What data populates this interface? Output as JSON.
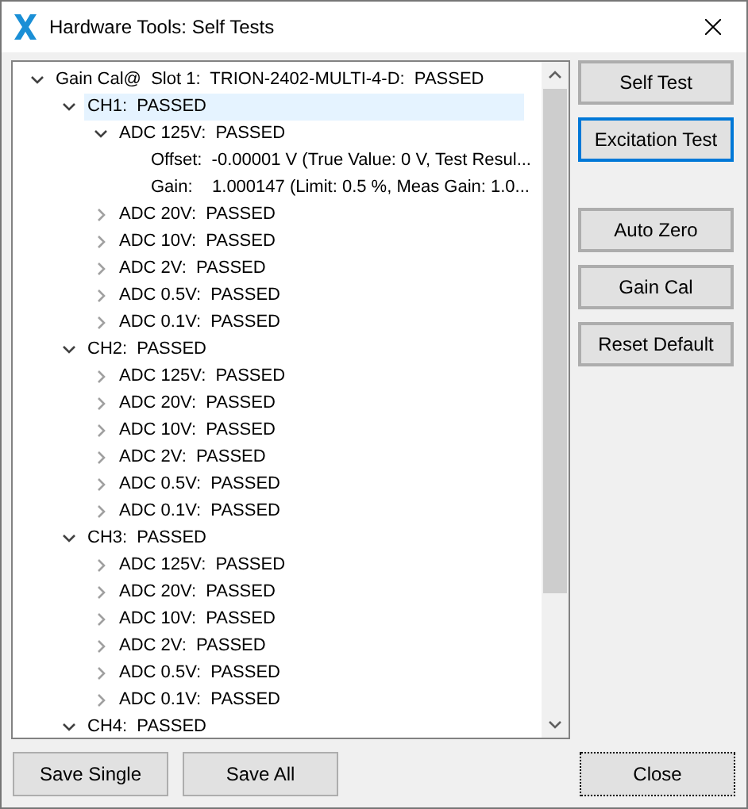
{
  "window": {
    "title": "Hardware Tools: Self Tests"
  },
  "tree": [
    {
      "label": "Gain Cal@  Slot 1:  TRION-2402-MULTI-4-D:  PASSED",
      "expanded": true,
      "selected": false,
      "children": [
        {
          "label": "CH1:  PASSED",
          "expanded": true,
          "selected": true,
          "children": [
            {
              "label": "ADC 125V:  PASSED",
              "expanded": true,
              "selected": false,
              "children": [
                {
                  "label": "Offset:  -0.00001 V (True Value: 0 V, Test Resul...",
                  "selected": false
                },
                {
                  "label": "Gain:    1.000147 (Limit: 0.5 %, Meas Gain: 1.0...",
                  "selected": false
                }
              ]
            },
            {
              "label": "ADC 20V:  PASSED",
              "expanded": false,
              "selected": false
            },
            {
              "label": "ADC 10V:  PASSED",
              "expanded": false,
              "selected": false
            },
            {
              "label": "ADC 2V:  PASSED",
              "expanded": false,
              "selected": false
            },
            {
              "label": "ADC 0.5V:  PASSED",
              "expanded": false,
              "selected": false
            },
            {
              "label": "ADC 0.1V:  PASSED",
              "expanded": false,
              "selected": false
            }
          ]
        },
        {
          "label": "CH2:  PASSED",
          "expanded": true,
          "selected": false,
          "children": [
            {
              "label": "ADC 125V:  PASSED",
              "expanded": false,
              "selected": false
            },
            {
              "label": "ADC 20V:  PASSED",
              "expanded": false,
              "selected": false
            },
            {
              "label": "ADC 10V:  PASSED",
              "expanded": false,
              "selected": false
            },
            {
              "label": "ADC 2V:  PASSED",
              "expanded": false,
              "selected": false
            },
            {
              "label": "ADC 0.5V:  PASSED",
              "expanded": false,
              "selected": false
            },
            {
              "label": "ADC 0.1V:  PASSED",
              "expanded": false,
              "selected": false
            }
          ]
        },
        {
          "label": "CH3:  PASSED",
          "expanded": true,
          "selected": false,
          "children": [
            {
              "label": "ADC 125V:  PASSED",
              "expanded": false,
              "selected": false
            },
            {
              "label": "ADC 20V:  PASSED",
              "expanded": false,
              "selected": false
            },
            {
              "label": "ADC 10V:  PASSED",
              "expanded": false,
              "selected": false
            },
            {
              "label": "ADC 2V:  PASSED",
              "expanded": false,
              "selected": false
            },
            {
              "label": "ADC 0.5V:  PASSED",
              "expanded": false,
              "selected": false
            },
            {
              "label": "ADC 0.1V:  PASSED",
              "expanded": false,
              "selected": false
            }
          ]
        },
        {
          "label": "CH4:  PASSED",
          "expanded": true,
          "selected": false
        }
      ]
    }
  ],
  "side_buttons": [
    {
      "label": "Self Test",
      "focused": false
    },
    {
      "label": "Excitation Test",
      "focused": true
    },
    {
      "label": "Auto Zero",
      "focused": false
    },
    {
      "label": "Gain Cal",
      "focused": false
    },
    {
      "label": "Reset Default",
      "focused": false
    }
  ],
  "bottom_buttons": [
    {
      "label": "Save Single"
    },
    {
      "label": "Save All"
    }
  ],
  "close_button": {
    "label": "Close"
  }
}
